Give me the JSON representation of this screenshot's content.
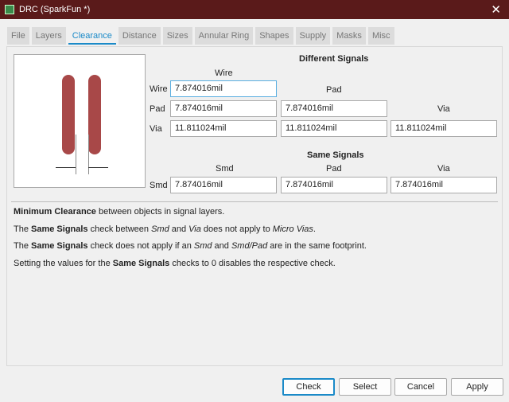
{
  "window": {
    "title": "DRC (SparkFun *)",
    "close": "✕"
  },
  "tabs": [
    "File",
    "Layers",
    "Clearance",
    "Distance",
    "Sizes",
    "Annular Ring",
    "Shapes",
    "Supply",
    "Masks",
    "Misc"
  ],
  "active_tab": "Clearance",
  "different": {
    "title": "Different Signals",
    "col_wire": "Wire",
    "col_pad": "Pad",
    "col_via": "Via",
    "row_wire": "Wire",
    "row_pad": "Pad",
    "row_via": "Via",
    "wire_wire": "7.874016mil",
    "pad_wire": "7.874016mil",
    "pad_pad": "7.874016mil",
    "via_wire": "11.811024mil",
    "via_pad": "11.811024mil",
    "via_via": "11.811024mil"
  },
  "same": {
    "title": "Same Signals",
    "col_smd": "Smd",
    "col_pad": "Pad",
    "col_via": "Via",
    "row_smd": "Smd",
    "smd_smd": "7.874016mil",
    "smd_pad": "7.874016mil",
    "smd_via": "7.874016mil"
  },
  "desc": {
    "l1a": "Minimum Clearance",
    "l1b": " between objects in signal layers.",
    "l2a": "The ",
    "l2b": "Same Signals",
    "l2c": " check between ",
    "l2d": "Smd",
    "l2e": " and ",
    "l2f": "Via",
    "l2g": " does not apply to ",
    "l2h": "Micro Vias",
    "l2i": ".",
    "l3a": "The ",
    "l3b": "Same Signals",
    "l3c": " check does not apply if an ",
    "l3d": "Smd",
    "l3e": " and ",
    "l3f": "Smd/Pad",
    "l3g": " are in the same footprint.",
    "l4a": "Setting the values for the ",
    "l4b": "Same Signals",
    "l4c": " checks to 0 disables the respective check."
  },
  "buttons": {
    "check": "Check",
    "select": "Select",
    "cancel": "Cancel",
    "apply": "Apply"
  }
}
